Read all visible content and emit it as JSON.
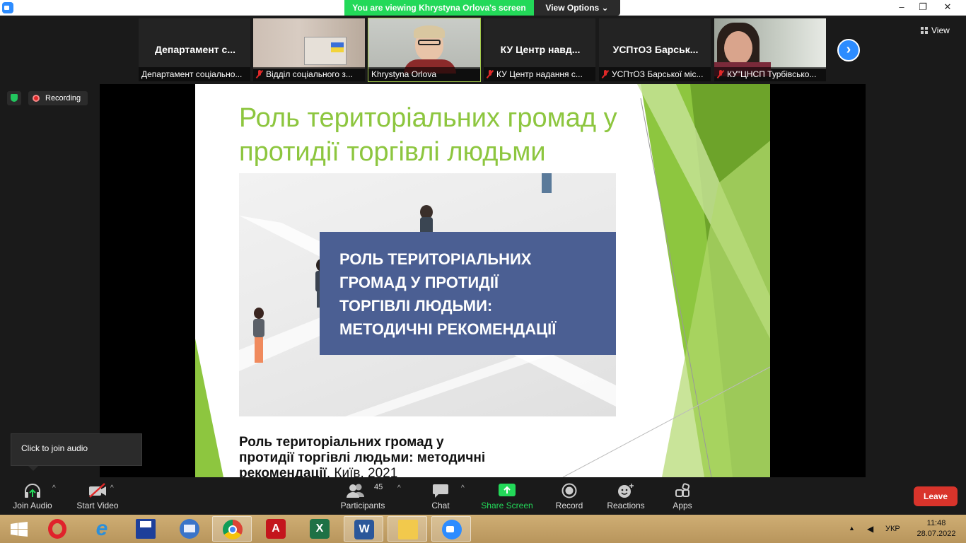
{
  "titlebar": {
    "viewing_text": "You are viewing Khrystyna Orlova's screen",
    "view_options_label": "View Options ⌄",
    "minimize": "–",
    "restore": "❐",
    "close": "✕"
  },
  "thumbnails": [
    {
      "title": "Департамент с...",
      "name": "Департамент соціально...",
      "muted": false
    },
    {
      "title": "",
      "name": "Відділ соціального з...",
      "muted": true
    },
    {
      "title": "",
      "name": "Khrystyna Orlova",
      "muted": false
    },
    {
      "title": "КУ Центр навд...",
      "name": "КУ Центр надання с...",
      "muted": true
    },
    {
      "title": "УСПтОЗ  Барськ...",
      "name": "УСПтОЗ Барської міс...",
      "muted": true
    },
    {
      "title": "",
      "name": "КУ\"ЦНСП Турбівсько...",
      "muted": true
    }
  ],
  "view_label": "View",
  "next_arrow": "›",
  "recording_label": "Recording",
  "slide": {
    "title": "Роль територіальних громад у протидії торгівлі людьми",
    "box_text": "РОЛЬ ТЕРИТОРІАЛЬНИХ\nГРОМАД У ПРОТИДІЇ\nТОРГІВЛІ ЛЮДЬМИ:\nМЕТОДИЧНІ РЕКОМЕНДАЦІЇ",
    "caption_bold": "Роль територіальних громад у протидії торгівлі людьми: методичні рекомендації",
    "caption_normal": ". Київ, 2021"
  },
  "tooltip": "Click to join audio",
  "toolbar": {
    "join_audio": "Join Audio",
    "start_video": "Start Video",
    "participants": "Participants",
    "participants_count": "45",
    "chat": "Chat",
    "share_screen": "Share Screen",
    "record": "Record",
    "reactions": "Reactions",
    "apps": "Apps",
    "leave": "Leave",
    "caret": "^"
  },
  "taskbar": {
    "apps": [
      "start",
      "opera",
      "internet-explorer",
      "save-disk",
      "thunderbird",
      "chrome",
      "acrobat",
      "excel",
      "word",
      "file-explorer",
      "zoom"
    ],
    "lang": "УКР",
    "time": "11:48",
    "date": "28.07.2022"
  },
  "colors": {
    "accent_green": "#23d959",
    "slide_green": "#8dc63f",
    "leave_red": "#d9342b",
    "zoom_blue": "#2d8cff"
  }
}
